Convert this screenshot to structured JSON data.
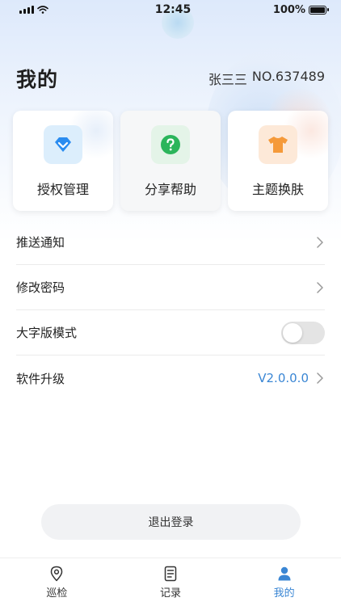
{
  "status_bar": {
    "time": "12:45",
    "battery": "100%"
  },
  "header": {
    "title": "我的",
    "user_name": "张三三",
    "user_no": "NO.637489"
  },
  "cards": [
    {
      "label": "授权管理",
      "icon": "diamond-icon",
      "color": "#2a8cf0",
      "bg": "#dceefc"
    },
    {
      "label": "分享帮助",
      "icon": "help-icon",
      "color": "#2bb55b",
      "bg": "#e4f4e8"
    },
    {
      "label": "主题换肤",
      "icon": "tshirt-icon",
      "color": "#f59a3a",
      "bg": "#fde9d8"
    }
  ],
  "menu": {
    "push_notice": "推送通知",
    "change_password": "修改密码",
    "large_font_mode": "大字版模式",
    "large_font_enabled": false,
    "software_upgrade": "软件升级",
    "version": "V2.0.0.0"
  },
  "logout_label": "退出登录",
  "tabs": [
    {
      "label": "巡检",
      "icon": "location-pin-icon",
      "active": false
    },
    {
      "label": "记录",
      "icon": "document-icon",
      "active": false
    },
    {
      "label": "我的",
      "icon": "user-icon",
      "active": true
    }
  ],
  "colors": {
    "accent": "#3a86d4"
  }
}
